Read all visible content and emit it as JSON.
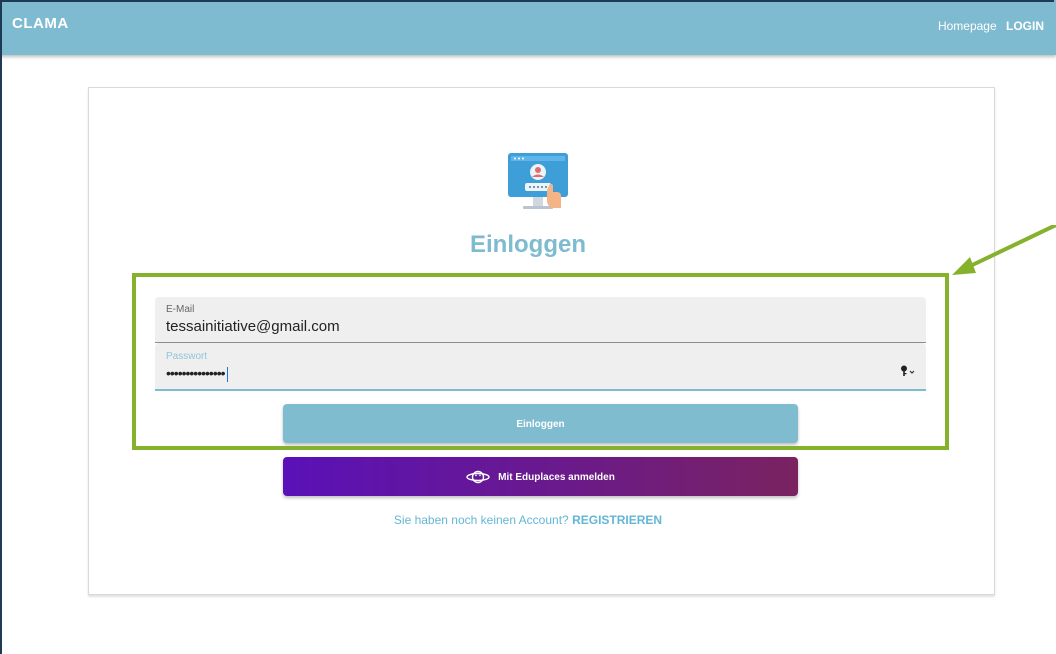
{
  "appbar": {
    "brand": "CLAMA",
    "nav": {
      "homepage": "Homepage",
      "login": "LOGIN"
    }
  },
  "login": {
    "title": "Einloggen",
    "email": {
      "label": "E-Mail",
      "value": "tessainitiative@gmail.com"
    },
    "password": {
      "label": "Passwort",
      "value": "•••••••••••••••"
    },
    "submit_label": "Einloggen",
    "eduplaces_label": "Mit Eduplaces anmelden",
    "register_prompt": "Sie haben noch keinen Account?",
    "register_link": "REGISTRIEREN"
  },
  "colors": {
    "primary": "#7ebbd0",
    "highlight": "#86b12c",
    "eduplaces_start": "#5a11b8",
    "eduplaces_end": "#7a2360"
  },
  "icons": [
    "login-illustration-icon",
    "key-icon",
    "eduplaces-planet-icon",
    "annotation-arrow-icon"
  ]
}
